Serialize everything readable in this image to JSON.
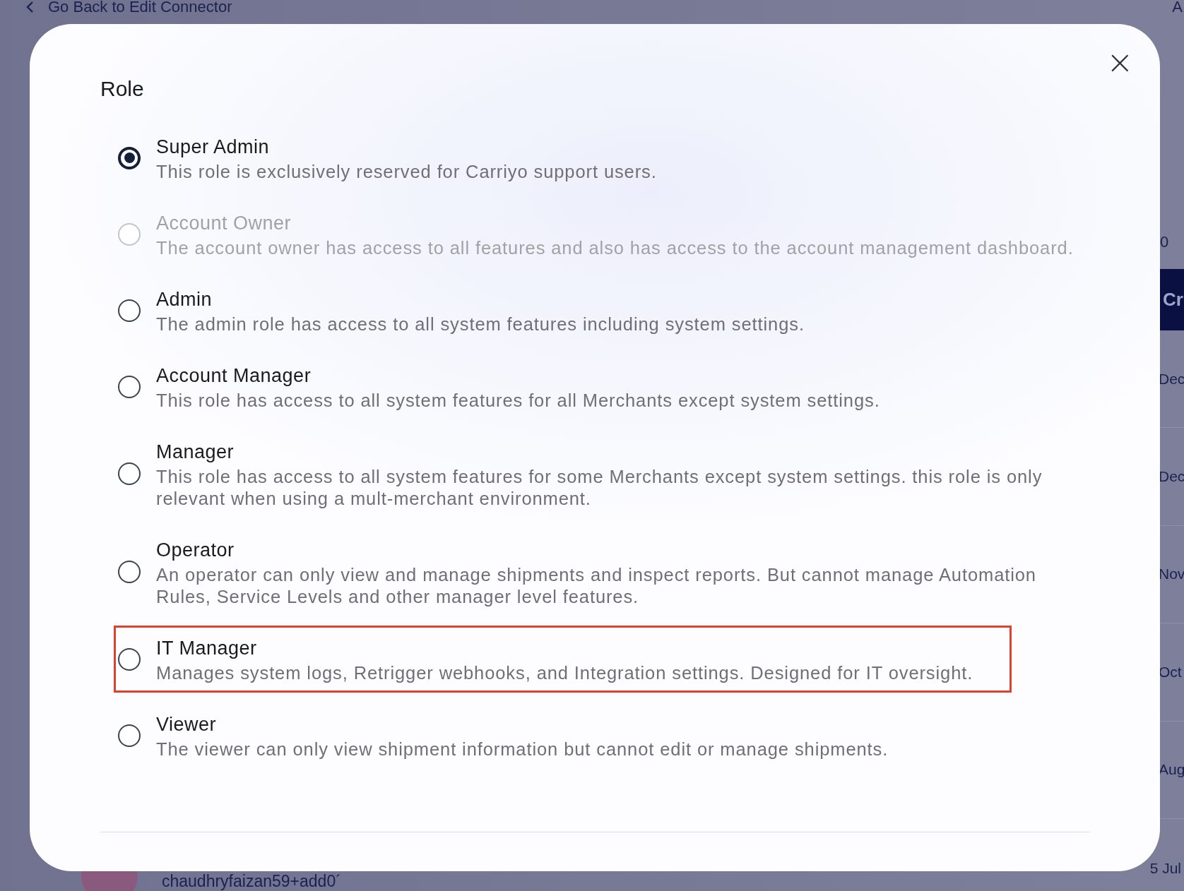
{
  "background": {
    "back_link": "Go Back to Edit Connector",
    "top_right": "A",
    "count": "0",
    "create_button": "Cr",
    "dates": [
      "Dec",
      "Dec",
      "Nov",
      "Oct",
      "Aug"
    ],
    "bottom_row": {
      "email": "chaudhryfaizan59+add0´",
      "date": "5 Jul"
    }
  },
  "modal": {
    "title": "Role",
    "close": "×",
    "roles": [
      {
        "name": "Super Admin",
        "description": "This role is exclusively reserved for Carriyo support users.",
        "selected": true,
        "disabled": false,
        "highlighted": false
      },
      {
        "name": "Account Owner",
        "description": "The account owner has access to all features and also has access to the account management dashboard.",
        "selected": false,
        "disabled": true,
        "highlighted": false
      },
      {
        "name": "Admin",
        "description": "The admin role has access to all system features including system settings.",
        "selected": false,
        "disabled": false,
        "highlighted": false
      },
      {
        "name": "Account Manager",
        "description": "This role has access to all system features for all Merchants except system settings.",
        "selected": false,
        "disabled": false,
        "highlighted": false
      },
      {
        "name": "Manager",
        "description": "This role has access to all system features for some Merchants except system settings. this role is only relevant when using a mult-merchant environment.",
        "selected": false,
        "disabled": false,
        "highlighted": false
      },
      {
        "name": "Operator",
        "description": "An operator can only view and manage shipments and inspect reports. But cannot manage Automation Rules, Service Levels and other manager level features.",
        "selected": false,
        "disabled": false,
        "highlighted": false
      },
      {
        "name": "IT Manager",
        "description": "Manages system logs, Retrigger webhooks, and Integration settings. Designed for IT oversight.",
        "selected": false,
        "disabled": false,
        "highlighted": true
      },
      {
        "name": "Viewer",
        "description": "The viewer can only view shipment information but cannot edit or manage shipments.",
        "selected": false,
        "disabled": false,
        "highlighted": false
      }
    ]
  }
}
